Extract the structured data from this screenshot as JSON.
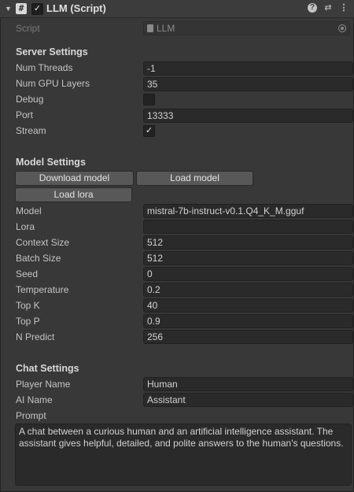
{
  "header": {
    "title": "LLM (Script)",
    "script_glyph": "#",
    "enabled": true
  },
  "script_field": {
    "label": "Script",
    "value": "LLM"
  },
  "server_settings": {
    "heading": "Server Settings",
    "num_threads": {
      "label": "Num Threads",
      "value": "-1"
    },
    "num_gpu_layers": {
      "label": "Num GPU Layers",
      "value": "35"
    },
    "debug": {
      "label": "Debug",
      "checked": false
    },
    "port": {
      "label": "Port",
      "value": "13333"
    },
    "stream": {
      "label": "Stream",
      "checked": true
    }
  },
  "model_settings": {
    "heading": "Model Settings",
    "download_model_label": "Download model",
    "load_model_label": "Load model",
    "load_lora_label": "Load lora",
    "model": {
      "label": "Model",
      "value": "mistral-7b-instruct-v0.1.Q4_K_M.gguf"
    },
    "lora": {
      "label": "Lora",
      "value": ""
    },
    "context_size": {
      "label": "Context Size",
      "value": "512"
    },
    "batch_size": {
      "label": "Batch Size",
      "value": "512"
    },
    "seed": {
      "label": "Seed",
      "value": "0"
    },
    "temperature": {
      "label": "Temperature",
      "value": "0.2"
    },
    "top_k": {
      "label": "Top K",
      "value": "40"
    },
    "top_p": {
      "label": "Top P",
      "value": "0.9"
    },
    "n_predict": {
      "label": "N Predict",
      "value": "256"
    }
  },
  "chat_settings": {
    "heading": "Chat Settings",
    "player_name": {
      "label": "Player Name",
      "value": "Human"
    },
    "ai_name": {
      "label": "AI Name",
      "value": "Assistant"
    },
    "prompt": {
      "label": "Prompt",
      "value": "A chat between a curious human and an artificial intelligence assistant. The assistant gives helpful, detailed, and polite answers to the human's questions."
    }
  },
  "icons": {
    "fold": "fold-arrow-icon",
    "script": "script-hash-icon",
    "help": "help-icon",
    "presets": "presets-icon",
    "menu": "kebab-menu-icon"
  },
  "colors": {
    "background": "#383838",
    "field_bg": "#2a2a2a",
    "button_bg": "#585858",
    "text": "#d2d2d2"
  }
}
